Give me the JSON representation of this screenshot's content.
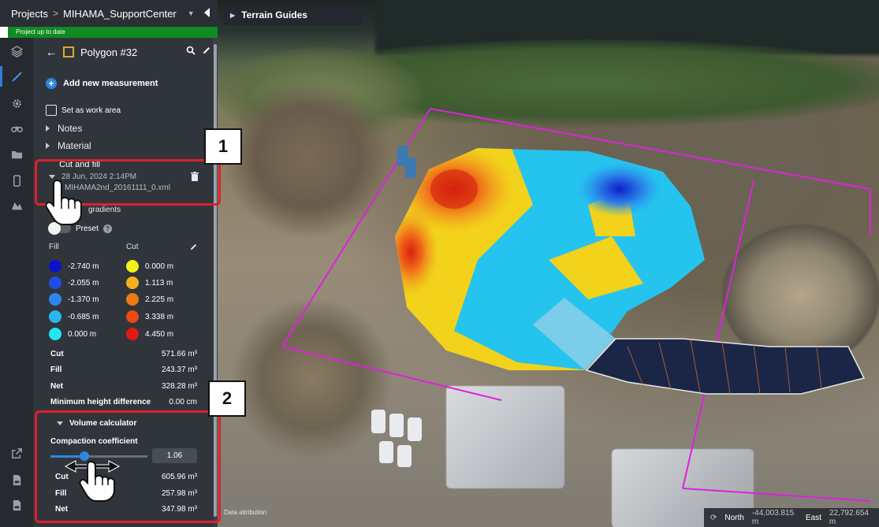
{
  "header": {
    "projects_label": "Projects",
    "project_name": "MIHAMA_SupportCenter",
    "status_text": "Project up to date"
  },
  "viewport": {
    "guide_label": "Terrain Guides",
    "attribution": "Data attribution",
    "north_label": "North",
    "north_value": "-44,003.815 m",
    "east_label": "East",
    "east_value": "22,792.654 m"
  },
  "panel": {
    "polygon_title": "Polygon #32",
    "add_measurement": "Add new measurement",
    "set_work_area": "Set as work area",
    "notes": "Notes",
    "material": "Material",
    "cut_fill_title": "Cut and fill",
    "cut_fill_date": "28 Jun, 2024 2:14PM",
    "cut_fill_file": "MIHAMA2nd_20161111_0.xml",
    "gradients": "gradients",
    "preset": "Preset",
    "fill_header": "Fill",
    "cut_header": "Cut",
    "fill_legend": [
      {
        "value": "-2.740 m",
        "color": "#0a12c8"
      },
      {
        "value": "-2.055 m",
        "color": "#1f4de8"
      },
      {
        "value": "-1.370 m",
        "color": "#2e86f0"
      },
      {
        "value": "-0.685 m",
        "color": "#27b7ef"
      },
      {
        "value": "0.000 m",
        "color": "#22e6f2"
      }
    ],
    "cut_legend": [
      {
        "value": "0.000 m",
        "color": "#f5f21a"
      },
      {
        "value": "1.113 m",
        "color": "#f5b11a"
      },
      {
        "value": "2.225 m",
        "color": "#f07a12"
      },
      {
        "value": "3.338 m",
        "color": "#ec4a12"
      },
      {
        "value": "4.450 m",
        "color": "#e01a12"
      }
    ],
    "stats": [
      {
        "label": "Cut",
        "value": "571.66 m³"
      },
      {
        "label": "Fill",
        "value": "243.37 m³"
      },
      {
        "label": "Net",
        "value": "328.28 m³"
      },
      {
        "label": "Minimum height difference",
        "value": "0.00 cm"
      }
    ],
    "volume_calculator": "Volume calculator",
    "compaction_label": "Compaction coefficient",
    "compaction_value": "1.06",
    "compaction_fraction": 0.35,
    "vol_stats": [
      {
        "label": "Cut",
        "value": "605.96 m³"
      },
      {
        "label": "Fill",
        "value": "257.98 m³"
      },
      {
        "label": "Net",
        "value": "347.98 m³"
      }
    ]
  },
  "callouts": {
    "one": "1",
    "two": "2"
  },
  "colors": {
    "accent": "#2e86e0",
    "status_green": "#0f8b22",
    "highlight_red": "#e2202a",
    "boundary_magenta": "#e020e0"
  }
}
